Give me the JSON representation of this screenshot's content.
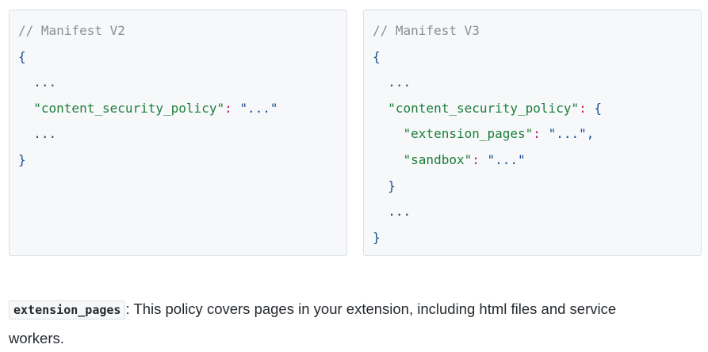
{
  "v2": {
    "comment": "// Manifest V2",
    "open_brace": "{",
    "ellipsis_1": "...",
    "key": "\"content_security_policy\"",
    "colon": ":",
    "value": "\"...\"",
    "ellipsis_2": "...",
    "close_brace": "}"
  },
  "v3": {
    "comment": "// Manifest V3",
    "open_brace": "{",
    "ellipsis_1": "...",
    "key": "\"content_security_policy\"",
    "colon": ":",
    "inner_open_brace": "{",
    "ext_key": "\"extension_pages\"",
    "ext_colon": ":",
    "ext_value": "\"...\"",
    "ext_comma": ",",
    "sandbox_key": "\"sandbox\"",
    "sandbox_colon": ":",
    "sandbox_value": "\"...\"",
    "inner_close_brace": "}",
    "ellipsis_2": "...",
    "close_brace": "}"
  },
  "description": {
    "code": "extension_pages",
    "text": ": This policy covers pages in your extension, including html files and service workers."
  }
}
